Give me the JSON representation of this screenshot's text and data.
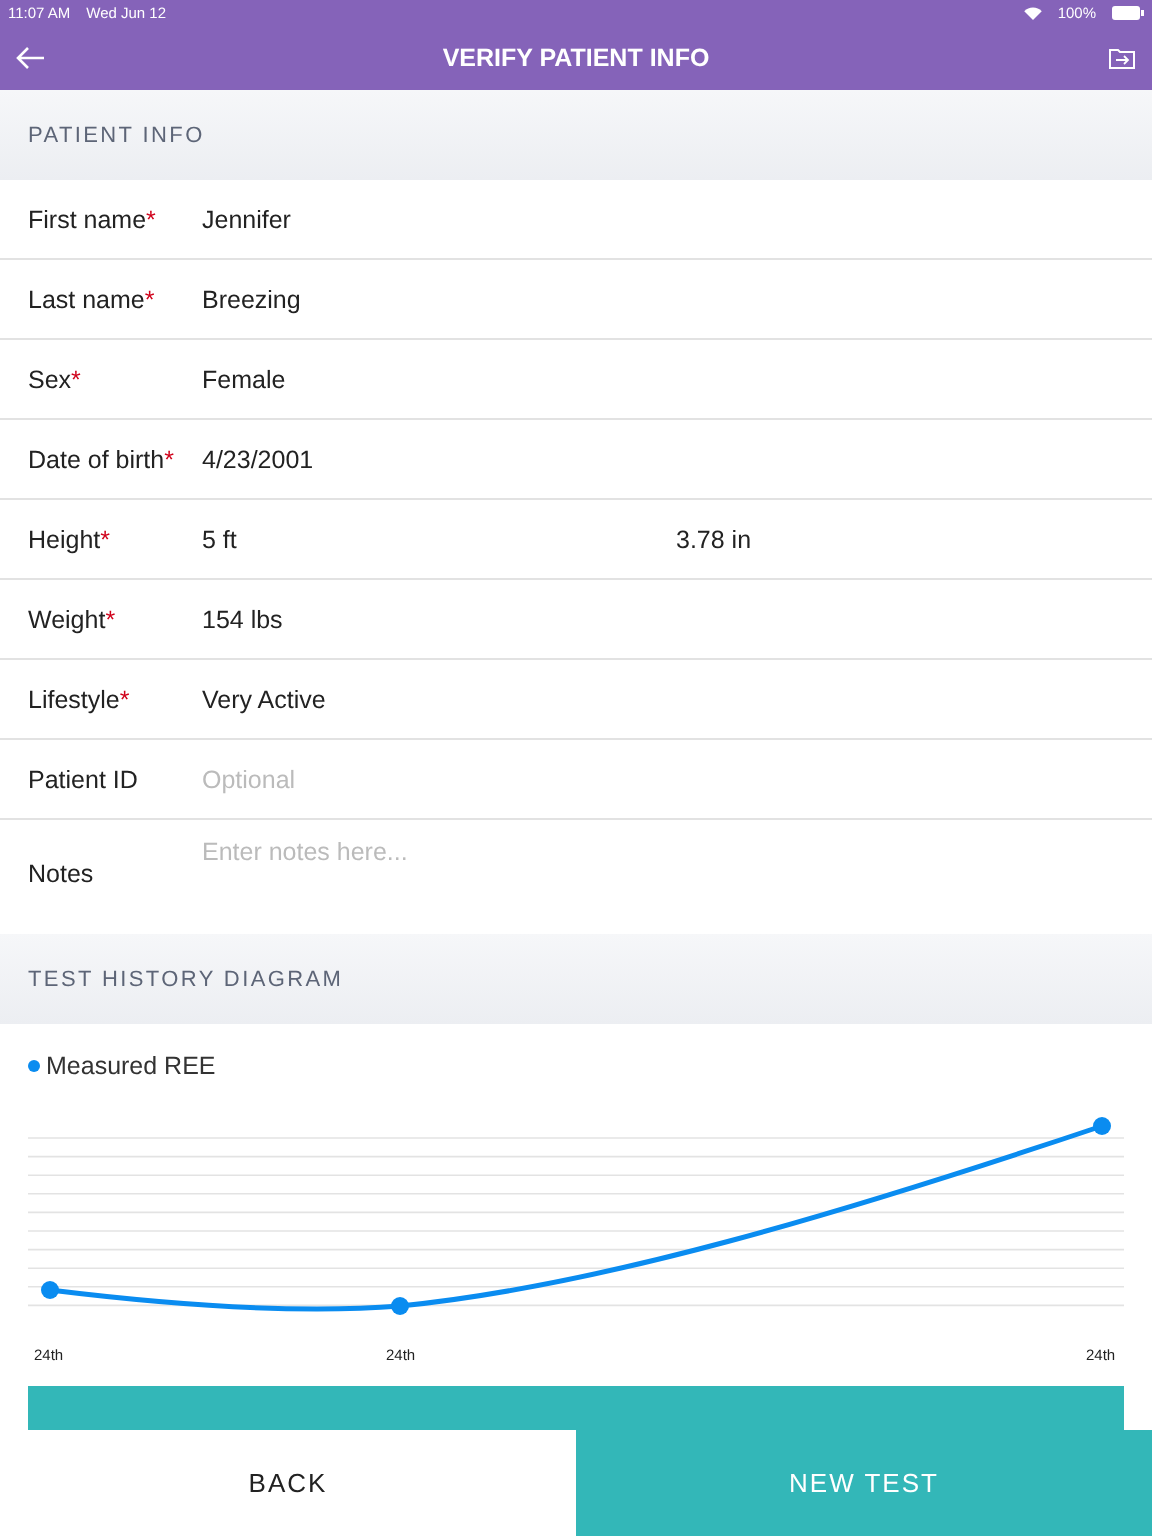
{
  "status_bar": {
    "time": "11:07 AM",
    "date": "Wed Jun 12",
    "battery": "100%"
  },
  "nav": {
    "title": "VERIFY PATIENT INFO"
  },
  "patient_info": {
    "header": "PATIENT INFO",
    "rows": [
      {
        "kind": "text",
        "label": "First name",
        "required_mark": "*",
        "value": "Jennifer"
      },
      {
        "kind": "text",
        "label": "Last name",
        "required_mark": "*",
        "value": "Breezing"
      },
      {
        "kind": "text",
        "label": "Sex",
        "required_mark": "*",
        "value": "Female"
      },
      {
        "kind": "text",
        "label": "Date of birth",
        "required_mark": "*",
        "value": "4/23/2001"
      },
      {
        "kind": "split",
        "label": "Height",
        "required_mark": "*",
        "value": "5 ft",
        "value_2": "3.78 in"
      },
      {
        "kind": "text",
        "label": "Weight",
        "required_mark": "*",
        "value": "154 lbs"
      },
      {
        "kind": "text",
        "label": "Lifestyle",
        "required_mark": "*",
        "value": "Very Active"
      },
      {
        "kind": "text",
        "label": "Patient ID",
        "placeholder": "Optional"
      },
      {
        "kind": "notes",
        "label": "Notes",
        "placeholder": "Enter notes here..."
      }
    ]
  },
  "test_history": {
    "header": "TEST HISTORY DIAGRAM",
    "legend": "Measured REE",
    "x_labels": [
      "24th",
      "24th",
      "24th"
    ]
  },
  "bottom_bar": {
    "buttons": [
      {
        "kind": "plain",
        "label": "BACK"
      },
      {
        "kind": "primary",
        "label": "NEW TEST"
      }
    ]
  }
}
